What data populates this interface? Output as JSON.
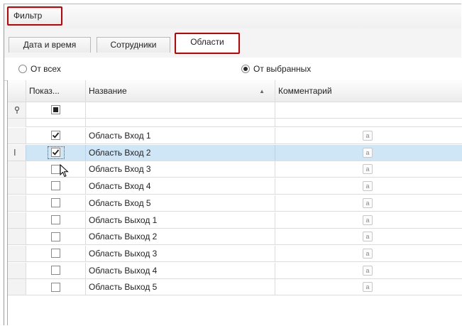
{
  "menu": {
    "filter_label": "Фильтр"
  },
  "tabs": [
    {
      "label": "Дата и время",
      "active": false
    },
    {
      "label": "Сотрудники",
      "active": false
    },
    {
      "label": "Области",
      "active": true
    }
  ],
  "radio": {
    "all_label": "От всех",
    "selected_label": "От выбранных",
    "checked": "selected"
  },
  "grid": {
    "columns": {
      "show": "Показ...",
      "name": "Название",
      "comment": "Комментарий"
    },
    "sorted_by": "name",
    "sort_direction": "ascending",
    "filter_row": {
      "show_state": "indeterminate"
    },
    "rows": [
      {
        "show": true,
        "name": "Область Вход 1",
        "selected": false
      },
      {
        "show": true,
        "name": "Область Вход 2",
        "selected": true
      },
      {
        "show": false,
        "name": "Область Вход 3",
        "selected": false
      },
      {
        "show": false,
        "name": "Область Вход 4",
        "selected": false
      },
      {
        "show": false,
        "name": "Область Вход 5",
        "selected": false
      },
      {
        "show": false,
        "name": "Область Выход 1",
        "selected": false
      },
      {
        "show": false,
        "name": "Область Выход 2",
        "selected": false
      },
      {
        "show": false,
        "name": "Область Выход 3",
        "selected": false
      },
      {
        "show": false,
        "name": "Область Выход 4",
        "selected": false
      },
      {
        "show": false,
        "name": "Область Выход 5",
        "selected": false
      }
    ],
    "comment_icon": "note-icon",
    "comment_icon_glyph": "a"
  },
  "colors": {
    "highlight_border": "#c40000",
    "selected_row": "#cfe6f7"
  }
}
